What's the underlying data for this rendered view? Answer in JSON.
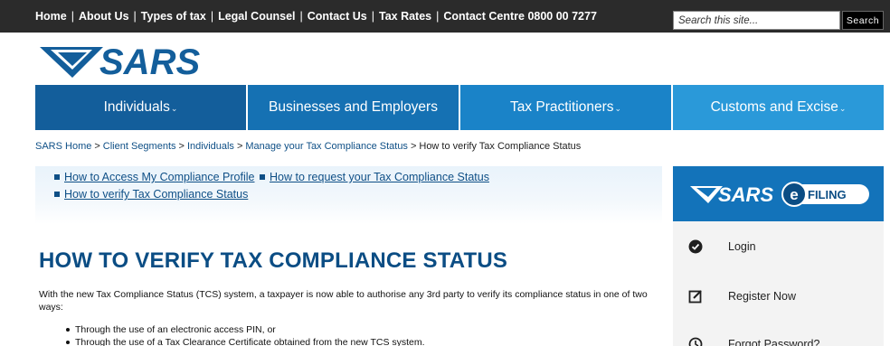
{
  "top_nav": {
    "items": [
      "Home",
      "About Us",
      "Types of tax",
      "Legal Counsel",
      "Contact Us",
      "Tax Rates",
      "Contact Centre 0800 00 7277"
    ],
    "separator": "|"
  },
  "search": {
    "placeholder": "Search this site...",
    "button_label": "Search"
  },
  "logo": {
    "text": "SARS"
  },
  "main_nav": [
    {
      "label": "Individuals",
      "has_dropdown": true
    },
    {
      "label": "Businesses and Employers",
      "has_dropdown": false
    },
    {
      "label": "Tax Practitioners",
      "has_dropdown": true
    },
    {
      "label": "Customs and Excise",
      "has_dropdown": true
    }
  ],
  "breadcrumb": {
    "links": [
      "SARS Home",
      "Client Segments",
      "Individuals",
      "Manage your Tax Compliance Status"
    ],
    "current": "How to verify Tax Compliance Status",
    "separator": ">"
  },
  "sub_nav": {
    "items": [
      "How to Access My Compliance Profile",
      "How to request your Tax Compliance Status",
      "How to verify Tax Compliance Status"
    ]
  },
  "page": {
    "title": "HOW TO VERIFY TAX COMPLIANCE STATUS",
    "intro": "With the new Tax Compliance Status (TCS) system, a taxpayer is now able to authorise any 3rd party to verify its compliance status in one of two ways:",
    "bullets": [
      "Through the use of an electronic access PIN, or",
      "Through the use of a Tax Clearance Certificate obtained from the new TCS system."
    ]
  },
  "sidebar": {
    "efiling_logo": {
      "brand": "SARS",
      "badge": "FILING",
      "badge_letter": "e"
    },
    "items": [
      {
        "label": "Login",
        "icon": "check-circle-icon"
      },
      {
        "label": "Register Now",
        "icon": "edit-icon"
      },
      {
        "label": "Forgot Password?",
        "icon": "clock-icon"
      }
    ]
  },
  "colors": {
    "top_bar": "#2b2b2b",
    "nav_individuals": "#135e9b",
    "nav_businesses": "#1571b3",
    "nav_practitioners": "#1a83c8",
    "nav_customs": "#2a99d9",
    "brand_blue": "#0b4d84",
    "efiling_blue": "#1373ba"
  }
}
